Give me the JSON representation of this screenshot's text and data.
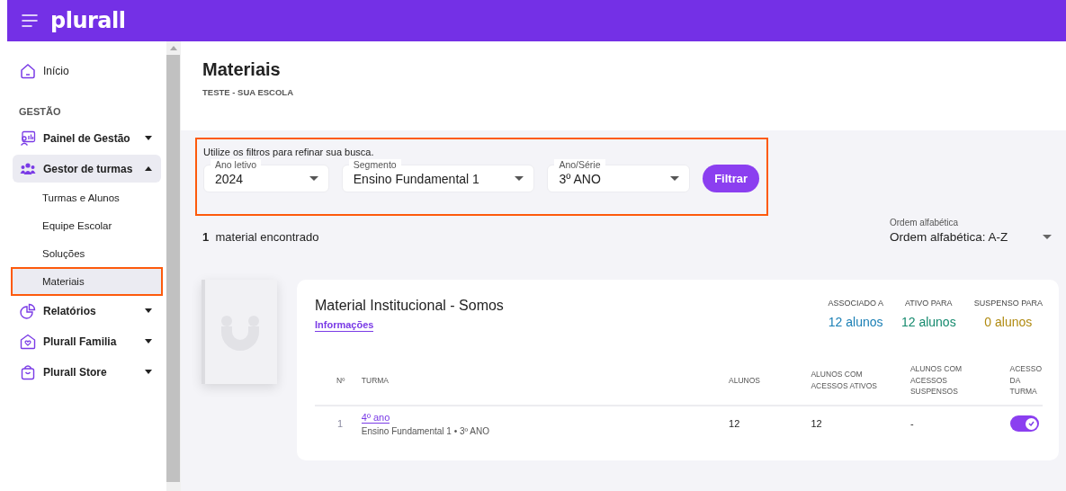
{
  "header": {
    "logo": "plurall"
  },
  "sidebar": {
    "items": [
      {
        "kind": "link",
        "label": "Início",
        "selected": false,
        "highlighted": false
      },
      {
        "kind": "heading",
        "label": "GESTÃO"
      },
      {
        "kind": "group",
        "label": "Painel de Gestão",
        "expanded": false,
        "selected": false,
        "highlighted": false
      },
      {
        "kind": "group",
        "label": "Gestor de turmas",
        "expanded": true,
        "selected": true,
        "highlighted": false,
        "children": [
          {
            "label": "Turmas e Alunos",
            "selected": false,
            "highlighted": false
          },
          {
            "label": "Equipe Escolar",
            "selected": false,
            "highlighted": false
          },
          {
            "label": "Soluções",
            "selected": false,
            "highlighted": false
          },
          {
            "label": "Materiais",
            "selected": true,
            "highlighted": true
          }
        ]
      },
      {
        "kind": "group",
        "label": "Relatórios",
        "expanded": false,
        "selected": false,
        "highlighted": false
      },
      {
        "kind": "group",
        "label": "Plurall Familia",
        "expanded": false,
        "selected": false,
        "highlighted": false
      },
      {
        "kind": "group",
        "label": "Plurall Store",
        "expanded": false,
        "selected": false,
        "highlighted": false
      }
    ]
  },
  "page": {
    "title": "Materiais",
    "subtitle": "TESTE - SUA ESCOLA"
  },
  "filters": {
    "hint": "Utilize os filtros para refinar sua busca.",
    "highlighted": true,
    "selects": [
      {
        "label": "Ano letivo",
        "value": "2024"
      },
      {
        "label": "Segmento",
        "value": "Ensino Fundamental 1"
      },
      {
        "label": "Ano/Série",
        "value": "3º ANO"
      }
    ],
    "button": "Filtrar"
  },
  "results": {
    "count": "1",
    "text": "material encontrado"
  },
  "sort": {
    "label": "Ordem alfabética",
    "value": "Ordem alfabética: A-Z"
  },
  "material": {
    "title": "Material Institucional - Somos",
    "info_link": "Informações",
    "stats": [
      {
        "label": "ASSOCIADO A",
        "value": "12 alunos",
        "color": "#1a7fb5"
      },
      {
        "label": "ATIVO PARA",
        "value": "12 alunos",
        "color": "#158a6e"
      },
      {
        "label": "SUSPENSO PARA",
        "value": "0 alunos",
        "color": "#b08a10"
      }
    ],
    "table": {
      "columns": [
        "Nº",
        "TURMA",
        "ALUNOS",
        "ALUNOS COM ACESSOS ATIVOS",
        "ALUNOS COM ACESSOS SUSPENSOS",
        "ACESSO DA TURMA"
      ],
      "rows": [
        {
          "number": "1",
          "turma": "4º ano",
          "detail": "Ensino Fundamental 1 • 3º ANO",
          "alunos": "12",
          "ativos": "12",
          "suspensos": "-",
          "access": true
        }
      ]
    }
  }
}
